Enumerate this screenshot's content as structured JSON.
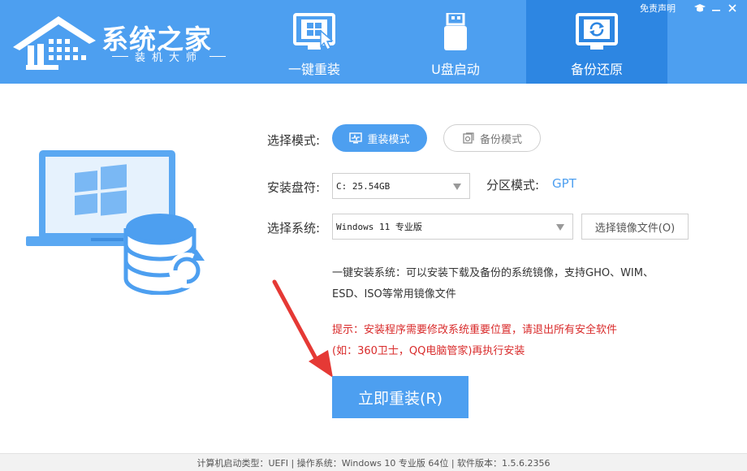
{
  "logo": {
    "title": "系统之家",
    "subtitle": "装机大师"
  },
  "nav": [
    {
      "label": "一键重装",
      "icon": "windows-cursor-icon",
      "active": false
    },
    {
      "label": "U盘启动",
      "icon": "usb-drive-icon",
      "active": false
    },
    {
      "label": "备份还原",
      "icon": "backup-restore-icon",
      "active": true
    }
  ],
  "top_links": {
    "disclaimer": "免责声明",
    "icons": [
      "graduation-cap-icon",
      "minimize-icon",
      "close-icon"
    ]
  },
  "form": {
    "mode_label": "选择模式:",
    "mode_reinstall": "重装模式",
    "mode_backup": "备份模式",
    "disk_label": "安装盘符:",
    "disk_value": "C: 25.54GB",
    "partition_label": "分区模式:",
    "partition_value": "GPT",
    "system_label": "选择系统:",
    "system_value": "Windows 11 专业版",
    "image_button": "选择镜像文件(O)"
  },
  "description": {
    "line1": "一键安装系统：可以安装下载及备份的系统镜像，支持GHO、WIM、",
    "line2": "ESD、ISO等常用镜像文件"
  },
  "tip": {
    "line1": "提示：安装程序需要修改系统重要位置，请退出所有安全软件",
    "line2": "(如：360卫士，QQ电脑管家)再执行安装"
  },
  "action": {
    "install_button": "立即重装(R)"
  },
  "footer": {
    "text": "计算机启动类型：UEFI | 操作系统：Windows 10 专业版 64位 | 软件版本：1.5.6.2356"
  },
  "colors": {
    "header": "#4d9ff0",
    "active_tab": "#2d86e2",
    "accent": "#4d9ff0",
    "tip": "#d92b2b",
    "arrow": "#e53935"
  }
}
